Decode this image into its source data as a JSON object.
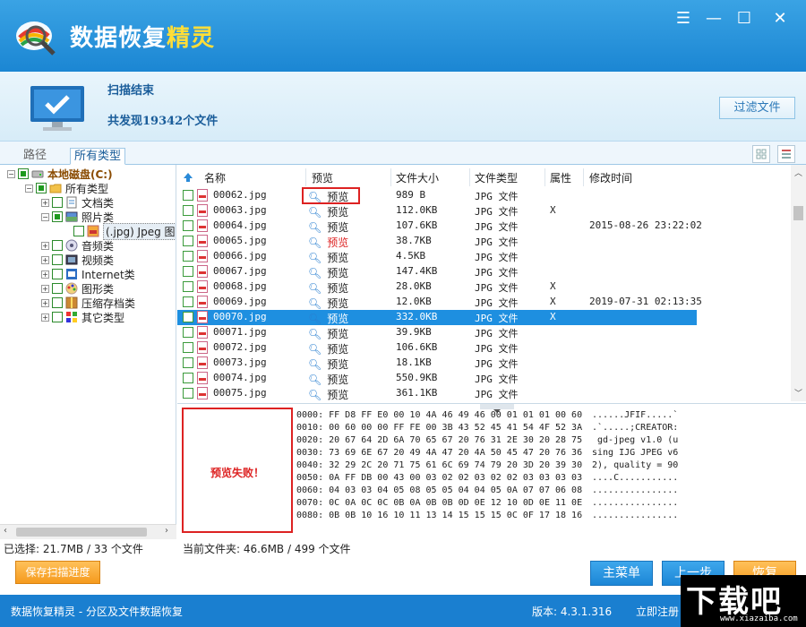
{
  "app": {
    "title_main": "数据恢复",
    "title_accent": "精灵"
  },
  "window_controls": {
    "menu": "☰",
    "minimize": "—",
    "maximize": "☐",
    "close": "✕"
  },
  "banner": {
    "status": "扫描结束",
    "found": "共发现19342个文件",
    "filter_button": "过滤文件"
  },
  "tabs": {
    "path": "路径",
    "all_types": "所有类型"
  },
  "tree": {
    "root": "本地磁盘(C:)",
    "all": "所有类型",
    "docs": "文档类",
    "photos": "照片类",
    "jpeg": "(.jpg) Jpeg 图",
    "audio": "音频类",
    "video": "视频类",
    "internet": "Internet类",
    "graphics": "图形类",
    "archive": "压缩存档类",
    "other": "其它类型"
  },
  "list": {
    "headers": {
      "name": "名称",
      "preview": "预览",
      "size": "文件大小",
      "type": "文件类型",
      "attr": "属性",
      "mtime": "修改时间"
    },
    "rows": [
      {
        "name": "00062.jpg",
        "preview": "预览",
        "size": "989 B",
        "type": "JPG 文件",
        "attr": "",
        "mtime": ""
      },
      {
        "name": "00063.jpg",
        "preview": "预览",
        "size": "112.0KB",
        "type": "JPG 文件",
        "attr": "X",
        "mtime": ""
      },
      {
        "name": "00064.jpg",
        "preview": "预览",
        "size": "107.6KB",
        "type": "JPG 文件",
        "attr": "",
        "mtime": "2015-08-26 23:22:02"
      },
      {
        "name": "00065.jpg",
        "preview": "预览",
        "size": "38.7KB",
        "type": "JPG 文件",
        "attr": "",
        "mtime": ""
      },
      {
        "name": "00066.jpg",
        "preview": "预览",
        "size": "4.5KB",
        "type": "JPG 文件",
        "attr": "",
        "mtime": ""
      },
      {
        "name": "00067.jpg",
        "preview": "预览",
        "size": "147.4KB",
        "type": "JPG 文件",
        "attr": "",
        "mtime": ""
      },
      {
        "name": "00068.jpg",
        "preview": "预览",
        "size": "28.0KB",
        "type": "JPG 文件",
        "attr": "X",
        "mtime": ""
      },
      {
        "name": "00069.jpg",
        "preview": "预览",
        "size": "12.0KB",
        "type": "JPG 文件",
        "attr": "X",
        "mtime": "2019-07-31 02:13:35"
      },
      {
        "name": "00070.jpg",
        "preview": "预览",
        "size": "332.0KB",
        "type": "JPG 文件",
        "attr": "X",
        "mtime": ""
      },
      {
        "name": "00071.jpg",
        "preview": "预览",
        "size": "39.9KB",
        "type": "JPG 文件",
        "attr": "",
        "mtime": ""
      },
      {
        "name": "00072.jpg",
        "preview": "预览",
        "size": "106.6KB",
        "type": "JPG 文件",
        "attr": "",
        "mtime": ""
      },
      {
        "name": "00073.jpg",
        "preview": "预览",
        "size": "18.1KB",
        "type": "JPG 文件",
        "attr": "",
        "mtime": ""
      },
      {
        "name": "00074.jpg",
        "preview": "预览",
        "size": "550.9KB",
        "type": "JPG 文件",
        "attr": "",
        "mtime": ""
      },
      {
        "name": "00075.jpg",
        "preview": "预览",
        "size": "361.1KB",
        "type": "JPG 文件",
        "attr": "",
        "mtime": ""
      }
    ]
  },
  "preview": {
    "failed": "预览失败！",
    "hex": [
      "0000: FF D8 FF E0 00 10 4A 46 49 46 00 01 01 01 00 60",
      "0010: 00 60 00 00 FF FE 00 3B 43 52 45 41 54 4F 52 3A",
      "0020: 20 67 64 2D 6A 70 65 67 20 76 31 2E 30 20 28 75",
      "0030: 73 69 6E 67 20 49 4A 47 20 4A 50 45 47 20 76 36",
      "0040: 32 29 2C 20 71 75 61 6C 69 74 79 20 3D 20 39 30",
      "0050: 0A FF DB 00 43 00 03 02 02 03 02 02 03 03 03 03",
      "0060: 04 03 03 04 05 08 05 05 04 04 05 0A 07 07 06 08",
      "0070: 0C 0A 0C 0C 0B 0A 0B 0B 0D 0E 12 10 0D 0E 11 0E",
      "0080: 0B 0B 10 16 10 11 13 14 15 15 15 0C 0F 17 18 16"
    ],
    "ascii": [
      "......JFIF.....`",
      ".`.....;CREATOR:",
      " gd-jpeg v1.0 (u",
      "sing IJG JPEG v6",
      "2), quality = 90",
      "....C...........",
      "................",
      "................",
      "................"
    ]
  },
  "status": {
    "selected": "已选择: 21.7MB / 33 个文件",
    "current": "当前文件夹: 46.6MB / 499 个文件"
  },
  "buttons": {
    "save_progress": "保存扫描进度",
    "main_menu": "主菜单",
    "prev_step": "上一步",
    "recover": "恢复"
  },
  "footer": {
    "left": "数据恢复精灵 - 分区及文件数据恢复",
    "version": "版本: 4.3.1.316",
    "register": "立即注册"
  },
  "watermark": {
    "main": "下载吧",
    "sub": "www.xiazaiba.com"
  }
}
